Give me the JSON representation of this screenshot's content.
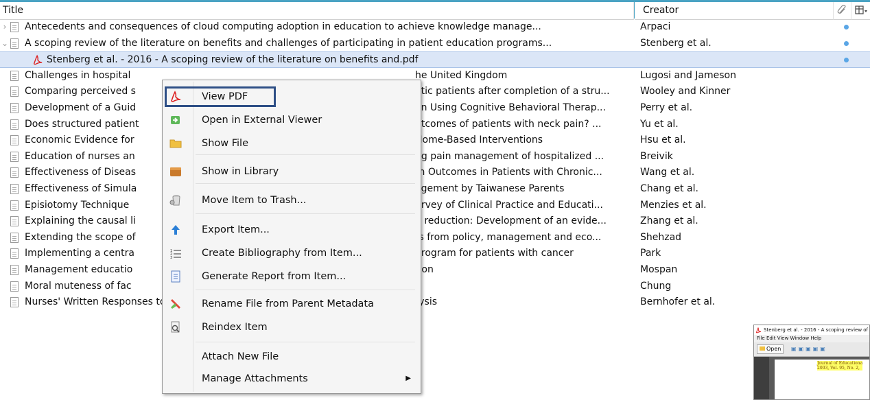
{
  "header": {
    "title": "Title",
    "creator": "Creator"
  },
  "rows": [
    {
      "title": "Antecedents and consequences of cloud computing adoption in education to achieve knowledge manage...",
      "creator": "Arpaci",
      "twisty": "›",
      "dot": true
    },
    {
      "title": "A scoping review of the literature on benefits and challenges of participating in patient education programs...",
      "creator": "Stenberg et al.",
      "twisty": "⌄",
      "dot": true
    },
    {
      "title": "Stenberg et al. - 2016 - A scoping review of the literature on benefits and.pdf",
      "creator": "",
      "child": true,
      "dot": true
    },
    {
      "title": "Challenges in hospital",
      "tail": "he United Kingdom",
      "creator": "Lugosi and Jameson"
    },
    {
      "title": "Comparing perceived s",
      "tail": "etic patients after completion of a stru...",
      "creator": "Wooley and Kinner"
    },
    {
      "title": "Development of a Guid",
      "tail": "on Using Cognitive Behavioral Therap...",
      "creator": "Perry et al."
    },
    {
      "title": "Does structured patient",
      "tail": "utcomes of patients with neck pain? ...",
      "creator": "Yu et al."
    },
    {
      "title": "Economic Evidence for",
      "tail": "Home-Based Interventions",
      "creator": "Hsu et al."
    },
    {
      "title": "Education of nurses an",
      "tail": "ng pain management of hospitalized ...",
      "creator": "Breivik"
    },
    {
      "title": "Effectiveness of Diseas",
      "tail": "th Outcomes in Patients with Chronic...",
      "creator": "Wang et al."
    },
    {
      "title": "Effectiveness of Simula",
      "tail": "agement by Taiwanese Parents",
      "creator": "Chang et al."
    },
    {
      "title": "Episiotomy Technique",
      "tail": "urvey of Clinical Practice and Educati...",
      "creator": "Menzies et al."
    },
    {
      "title": "Explaining the causal li",
      "tail": "n reduction: Development of an evide...",
      "creator": "Zhang et al."
    },
    {
      "title": "Extending the scope of",
      "tail": "ts from policy, management and eco...",
      "creator": "Shehzad"
    },
    {
      "title": "Implementing a centra",
      "tail": "program for patients with cancer",
      "creator": "Park"
    },
    {
      "title": "Management educatio",
      "tail": "tion",
      "creator": "Mospan"
    },
    {
      "title": "Moral muteness of fac",
      "tail": "",
      "creator": "Chung"
    },
    {
      "title": "Nurses' Written Responses to Pain Management Values Education: A Content Analysis",
      "creator": "Bernhofer et al."
    }
  ],
  "context_menu": {
    "items": [
      {
        "label": "View PDF",
        "icon": "pdf-icon"
      },
      {
        "label": "Open in External Viewer",
        "icon": "external-viewer-icon"
      },
      {
        "label": "Show File",
        "icon": "folder-icon"
      },
      {
        "label": "Show in Library",
        "icon": "library-icon"
      },
      {
        "label": "Move Item to Trash...",
        "icon": "trash-icon"
      },
      {
        "label": "Export Item...",
        "icon": "export-icon"
      },
      {
        "label": "Create Bibliography from Item...",
        "icon": "bibliography-icon"
      },
      {
        "label": "Generate Report from Item...",
        "icon": "report-icon"
      },
      {
        "label": "Rename File from Parent Metadata",
        "icon": "rename-icon"
      },
      {
        "label": "Reindex Item",
        "icon": "reindex-icon"
      },
      {
        "label": "Attach New File",
        "icon": ""
      },
      {
        "label": "Manage Attachments",
        "icon": "",
        "submenu": true
      }
    ]
  },
  "pdf_viewer": {
    "title": "Stenberg et al. - 2016 - A scoping review of the",
    "menubar": "File   Edit   View   Window   Help",
    "open_label": "Open",
    "journal_line1": "Journal of Educationa",
    "journal_line2": "2003, Vol. 95, No. 2,"
  },
  "colors": {
    "accent": "#4aa3c3",
    "selection": "#dbe6f7",
    "highlight_box": "#2e4f86",
    "attachment_dot": "#5aa6e6"
  }
}
